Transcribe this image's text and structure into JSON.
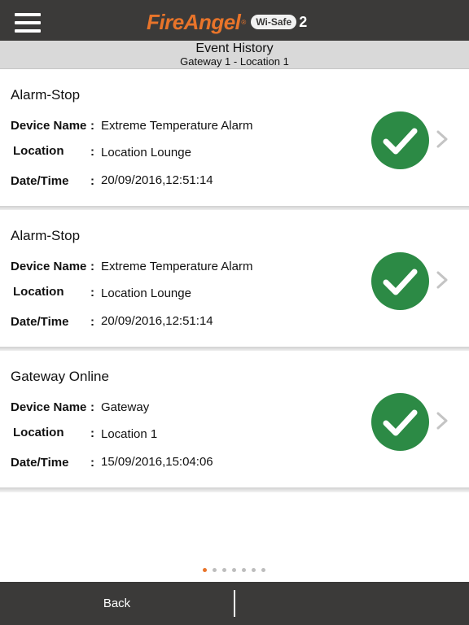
{
  "header": {
    "brand": "FireAngel",
    "brand_mark": "®",
    "badge": "Wi-Safe",
    "badge_num": "2",
    "menu_icon": "hamburger-menu-icon"
  },
  "subheader": {
    "title": "Event History",
    "subtitle": "Gateway 1 - Location 1"
  },
  "labels": {
    "device_name": "Device Name",
    "location": "Location",
    "datetime": "Date/Time",
    "colon": ":"
  },
  "events": [
    {
      "title": "Alarm-Stop",
      "device_name": "Extreme Temperature Alarm",
      "location": "Location Lounge",
      "datetime": "20/09/2016,12:51:14",
      "status_icon": "check-circle-icon"
    },
    {
      "title": "Alarm-Stop",
      "device_name": "Extreme Temperature Alarm",
      "location": "Location Lounge",
      "datetime": "20/09/2016,12:51:14",
      "status_icon": "check-circle-icon"
    },
    {
      "title": "Gateway Online",
      "device_name": "Gateway",
      "location": "Location 1",
      "datetime": "15/09/2016,15:04:06",
      "status_icon": "check-circle-icon"
    }
  ],
  "pager": {
    "count": 7,
    "active": 1
  },
  "footer": {
    "back_label": "Back"
  },
  "colors": {
    "accent": "#e8742a",
    "status_green": "#2c8a45",
    "bar": "#3b3a39"
  }
}
